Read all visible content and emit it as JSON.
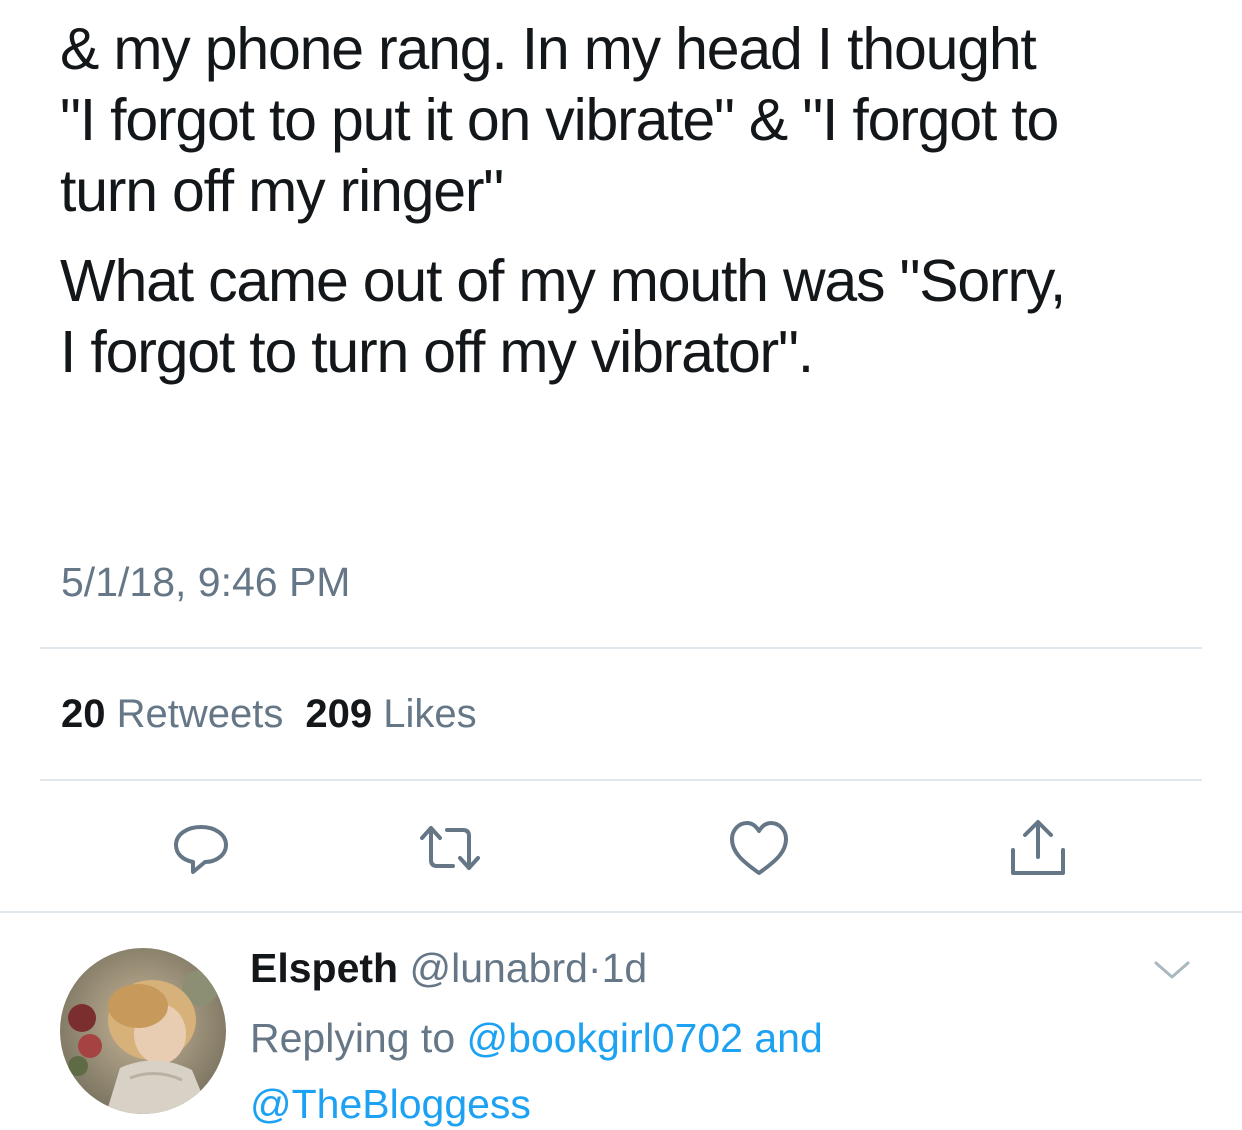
{
  "tweet": {
    "text_lines": [
      "& my phone rang. In my head I thought",
      "\"I forgot to put it on vibrate\" & \"I forgot to",
      "turn off my ringer\""
    ],
    "text_lines_2": [
      "What came out of my mouth was \"Sorry,",
      "I forgot to turn off my vibrator\"."
    ],
    "timestamp": "5/1/18, 9:46 PM"
  },
  "stats": {
    "retweets_count": "20",
    "retweets_label": "Retweets",
    "likes_count": "209",
    "likes_label": "Likes"
  },
  "actions": [
    {
      "icon": "reply-icon"
    },
    {
      "icon": "retweet-icon"
    },
    {
      "icon": "like-icon"
    },
    {
      "icon": "share-icon"
    }
  ],
  "reply": {
    "name": "Elspeth",
    "handle": "@lunabrd",
    "separator": "·",
    "age": "1d",
    "replying_prefix": "Replying to",
    "mention_1": "@bookgirl0702",
    "conjunction": "and",
    "mention_2": "@TheBloggess"
  },
  "colors": {
    "text": "#14171a",
    "secondary": "#657786",
    "link": "#1da1f2",
    "divider": "#e1e8ed",
    "icon": "#657786"
  }
}
